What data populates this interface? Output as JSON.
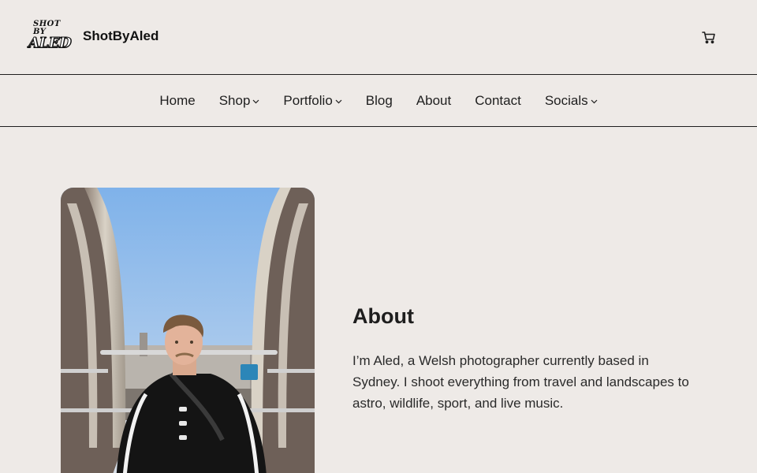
{
  "header": {
    "logo_text_top": "SHOT BY",
    "logo_text_bottom": "ALED",
    "site_title": "ShotByAled",
    "cart_icon": "cart-icon"
  },
  "nav": {
    "items": [
      {
        "label": "Home",
        "has_dropdown": false
      },
      {
        "label": "Shop",
        "has_dropdown": true
      },
      {
        "label": "Portfolio",
        "has_dropdown": true
      },
      {
        "label": "Blog",
        "has_dropdown": false
      },
      {
        "label": "About",
        "has_dropdown": false
      },
      {
        "label": "Contact",
        "has_dropdown": false
      },
      {
        "label": "Socials",
        "has_dropdown": true
      }
    ]
  },
  "about": {
    "heading": "About",
    "body": "I’m Aled, a Welsh photographer currently based in Sydney. I shoot everything from travel and landscapes to astro, wildlife, sport, and live music."
  },
  "colors": {
    "background": "#eeeae7",
    "text": "#1e1e1e",
    "border": "#1e1e1e"
  }
}
